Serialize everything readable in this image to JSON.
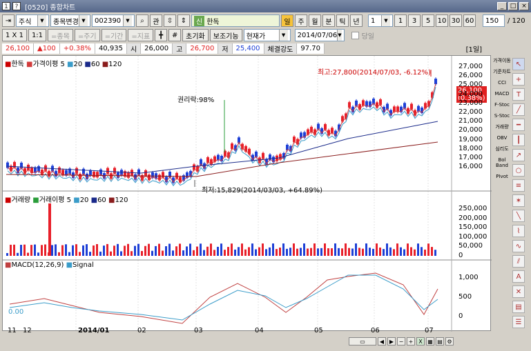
{
  "window": {
    "icon1": "1",
    "icon2": "?",
    "title": "[0520] 종합차트",
    "btn_min": "_",
    "btn_max": "□",
    "btn_close": "×"
  },
  "toolbar1": {
    "market": "주식",
    "mode": "종목변경",
    "code": "002390",
    "search": "⌕",
    "tube": "관",
    "prev_next": "⇳",
    "badge": "신",
    "stock_name": "한독",
    "periods": [
      "주",
      "월",
      "분",
      "틱",
      "년"
    ],
    "period_value": "1",
    "period_quick": [
      "1",
      "3",
      "5",
      "10",
      "30",
      "60"
    ],
    "count_value": "150",
    "count_total": "/ 120"
  },
  "toolbar2": {
    "scale": "1 X 1",
    "scale2": "1:1",
    "buttons": [
      "=종목",
      "=주기",
      "=기간",
      "=지표"
    ],
    "reset": "초기화",
    "aux": "보조기능",
    "price_mode": "현재가",
    "date": "2014/07/06",
    "today_label": "당일"
  },
  "quote": {
    "price": "26,100",
    "change": "▲100",
    "change_pct": "+0.38%",
    "volume": "40,935",
    "open_label": "시",
    "open": "26,000",
    "high_label": "고",
    "high": "26,700",
    "low_label": "저",
    "low": "25,400",
    "strength_label": "체결강도",
    "strength": "97.70",
    "period_tag": "[1일]"
  },
  "price_panel": {
    "legend_name": "한독",
    "legend_ma": "가격이평 5",
    "legend_periods": [
      "20",
      "60",
      "120"
    ],
    "max_annotation": "최고:27,800(2014/07/03, -6.12%)",
    "min_annotation": "최저:15,829(2014/03/03, +64.89%)",
    "event_annotation": "권리락:98%",
    "current_price": "26,100",
    "current_pct": "(0.38%)",
    "axis": [
      "27,000",
      "26,000",
      "25,000",
      "24,000",
      "23,000",
      "22,000",
      "21,000",
      "20,000",
      "19,000",
      "18,000",
      "17,000",
      "16,000"
    ],
    "colors": {
      "up": "#e8202a",
      "down": "#1d3fd6",
      "ma5": "#d23c3c",
      "ma20": "#3a9cc9",
      "ma60": "#1a2a8a",
      "ma120": "#8a1c1c"
    }
  },
  "volume_panel": {
    "legend_name": "거래량",
    "legend_ma": "거래이평 5",
    "legend_periods": [
      "20",
      "60",
      "120"
    ],
    "axis": [
      "250,000",
      "200,000",
      "150,000",
      "100,000",
      "50,000",
      "0"
    ]
  },
  "macd_panel": {
    "legend_macd": "MACD(12,26,9)",
    "legend_signal": "Signal",
    "axis": [
      "1,000",
      "500",
      "0"
    ],
    "zero_label": "0.00"
  },
  "xaxis": [
    "11",
    "12",
    "2014/01",
    "02",
    "03",
    "04",
    "05",
    "06",
    "07"
  ],
  "side_buttons": [
    "가격이동",
    "기준차트",
    "CCI",
    "MACD",
    "F-Stoc",
    "S-Stoc",
    "거래량",
    "OBV",
    "심리도",
    "Bol Band",
    "PIvot"
  ],
  "tool_icons": [
    "cursor-icon",
    "crosshair-icon",
    "text-icon",
    "trendline-icon",
    "horizontal-line-icon",
    "vertical-line-icon",
    "ray-icon",
    "circle-icon",
    "fibonacci-icon",
    "gann-icon",
    "andrews-icon",
    "zigzag-icon",
    "wave-icon",
    "channel-icon",
    "auto-icon",
    "delete-icon",
    "print-icon",
    "settings-icon"
  ],
  "tool_glyphs": [
    "↖",
    "+",
    "T",
    "╱",
    "━",
    "┃",
    "↗",
    "○",
    "≡",
    "✶",
    "╲",
    "⌇",
    "∿",
    "⫽",
    "A",
    "✕",
    "▤",
    "☰"
  ]
}
